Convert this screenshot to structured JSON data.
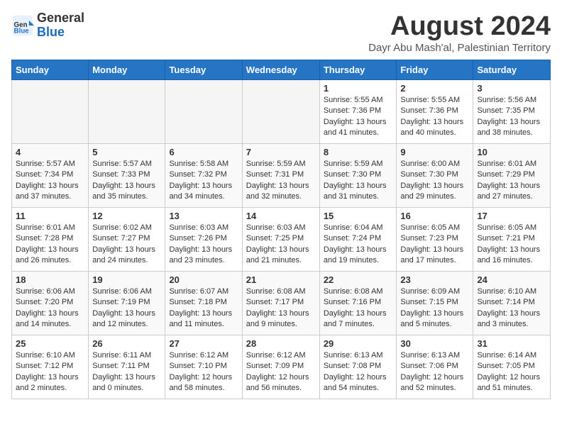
{
  "header": {
    "logo_line1": "General",
    "logo_line2": "Blue",
    "month_year": "August 2024",
    "location": "Dayr Abu Mash'al, Palestinian Territory"
  },
  "weekdays": [
    "Sunday",
    "Monday",
    "Tuesday",
    "Wednesday",
    "Thursday",
    "Friday",
    "Saturday"
  ],
  "weeks": [
    [
      {
        "day": "",
        "info": ""
      },
      {
        "day": "",
        "info": ""
      },
      {
        "day": "",
        "info": ""
      },
      {
        "day": "",
        "info": ""
      },
      {
        "day": "1",
        "info": "Sunrise: 5:55 AM\nSunset: 7:36 PM\nDaylight: 13 hours\nand 41 minutes."
      },
      {
        "day": "2",
        "info": "Sunrise: 5:55 AM\nSunset: 7:36 PM\nDaylight: 13 hours\nand 40 minutes."
      },
      {
        "day": "3",
        "info": "Sunrise: 5:56 AM\nSunset: 7:35 PM\nDaylight: 13 hours\nand 38 minutes."
      }
    ],
    [
      {
        "day": "4",
        "info": "Sunrise: 5:57 AM\nSunset: 7:34 PM\nDaylight: 13 hours\nand 37 minutes."
      },
      {
        "day": "5",
        "info": "Sunrise: 5:57 AM\nSunset: 7:33 PM\nDaylight: 13 hours\nand 35 minutes."
      },
      {
        "day": "6",
        "info": "Sunrise: 5:58 AM\nSunset: 7:32 PM\nDaylight: 13 hours\nand 34 minutes."
      },
      {
        "day": "7",
        "info": "Sunrise: 5:59 AM\nSunset: 7:31 PM\nDaylight: 13 hours\nand 32 minutes."
      },
      {
        "day": "8",
        "info": "Sunrise: 5:59 AM\nSunset: 7:30 PM\nDaylight: 13 hours\nand 31 minutes."
      },
      {
        "day": "9",
        "info": "Sunrise: 6:00 AM\nSunset: 7:30 PM\nDaylight: 13 hours\nand 29 minutes."
      },
      {
        "day": "10",
        "info": "Sunrise: 6:01 AM\nSunset: 7:29 PM\nDaylight: 13 hours\nand 27 minutes."
      }
    ],
    [
      {
        "day": "11",
        "info": "Sunrise: 6:01 AM\nSunset: 7:28 PM\nDaylight: 13 hours\nand 26 minutes."
      },
      {
        "day": "12",
        "info": "Sunrise: 6:02 AM\nSunset: 7:27 PM\nDaylight: 13 hours\nand 24 minutes."
      },
      {
        "day": "13",
        "info": "Sunrise: 6:03 AM\nSunset: 7:26 PM\nDaylight: 13 hours\nand 23 minutes."
      },
      {
        "day": "14",
        "info": "Sunrise: 6:03 AM\nSunset: 7:25 PM\nDaylight: 13 hours\nand 21 minutes."
      },
      {
        "day": "15",
        "info": "Sunrise: 6:04 AM\nSunset: 7:24 PM\nDaylight: 13 hours\nand 19 minutes."
      },
      {
        "day": "16",
        "info": "Sunrise: 6:05 AM\nSunset: 7:23 PM\nDaylight: 13 hours\nand 17 minutes."
      },
      {
        "day": "17",
        "info": "Sunrise: 6:05 AM\nSunset: 7:21 PM\nDaylight: 13 hours\nand 16 minutes."
      }
    ],
    [
      {
        "day": "18",
        "info": "Sunrise: 6:06 AM\nSunset: 7:20 PM\nDaylight: 13 hours\nand 14 minutes."
      },
      {
        "day": "19",
        "info": "Sunrise: 6:06 AM\nSunset: 7:19 PM\nDaylight: 13 hours\nand 12 minutes."
      },
      {
        "day": "20",
        "info": "Sunrise: 6:07 AM\nSunset: 7:18 PM\nDaylight: 13 hours\nand 11 minutes."
      },
      {
        "day": "21",
        "info": "Sunrise: 6:08 AM\nSunset: 7:17 PM\nDaylight: 13 hours\nand 9 minutes."
      },
      {
        "day": "22",
        "info": "Sunrise: 6:08 AM\nSunset: 7:16 PM\nDaylight: 13 hours\nand 7 minutes."
      },
      {
        "day": "23",
        "info": "Sunrise: 6:09 AM\nSunset: 7:15 PM\nDaylight: 13 hours\nand 5 minutes."
      },
      {
        "day": "24",
        "info": "Sunrise: 6:10 AM\nSunset: 7:14 PM\nDaylight: 13 hours\nand 3 minutes."
      }
    ],
    [
      {
        "day": "25",
        "info": "Sunrise: 6:10 AM\nSunset: 7:12 PM\nDaylight: 13 hours\nand 2 minutes."
      },
      {
        "day": "26",
        "info": "Sunrise: 6:11 AM\nSunset: 7:11 PM\nDaylight: 13 hours\nand 0 minutes."
      },
      {
        "day": "27",
        "info": "Sunrise: 6:12 AM\nSunset: 7:10 PM\nDaylight: 12 hours\nand 58 minutes."
      },
      {
        "day": "28",
        "info": "Sunrise: 6:12 AM\nSunset: 7:09 PM\nDaylight: 12 hours\nand 56 minutes."
      },
      {
        "day": "29",
        "info": "Sunrise: 6:13 AM\nSunset: 7:08 PM\nDaylight: 12 hours\nand 54 minutes."
      },
      {
        "day": "30",
        "info": "Sunrise: 6:13 AM\nSunset: 7:06 PM\nDaylight: 12 hours\nand 52 minutes."
      },
      {
        "day": "31",
        "info": "Sunrise: 6:14 AM\nSunset: 7:05 PM\nDaylight: 12 hours\nand 51 minutes."
      }
    ]
  ]
}
